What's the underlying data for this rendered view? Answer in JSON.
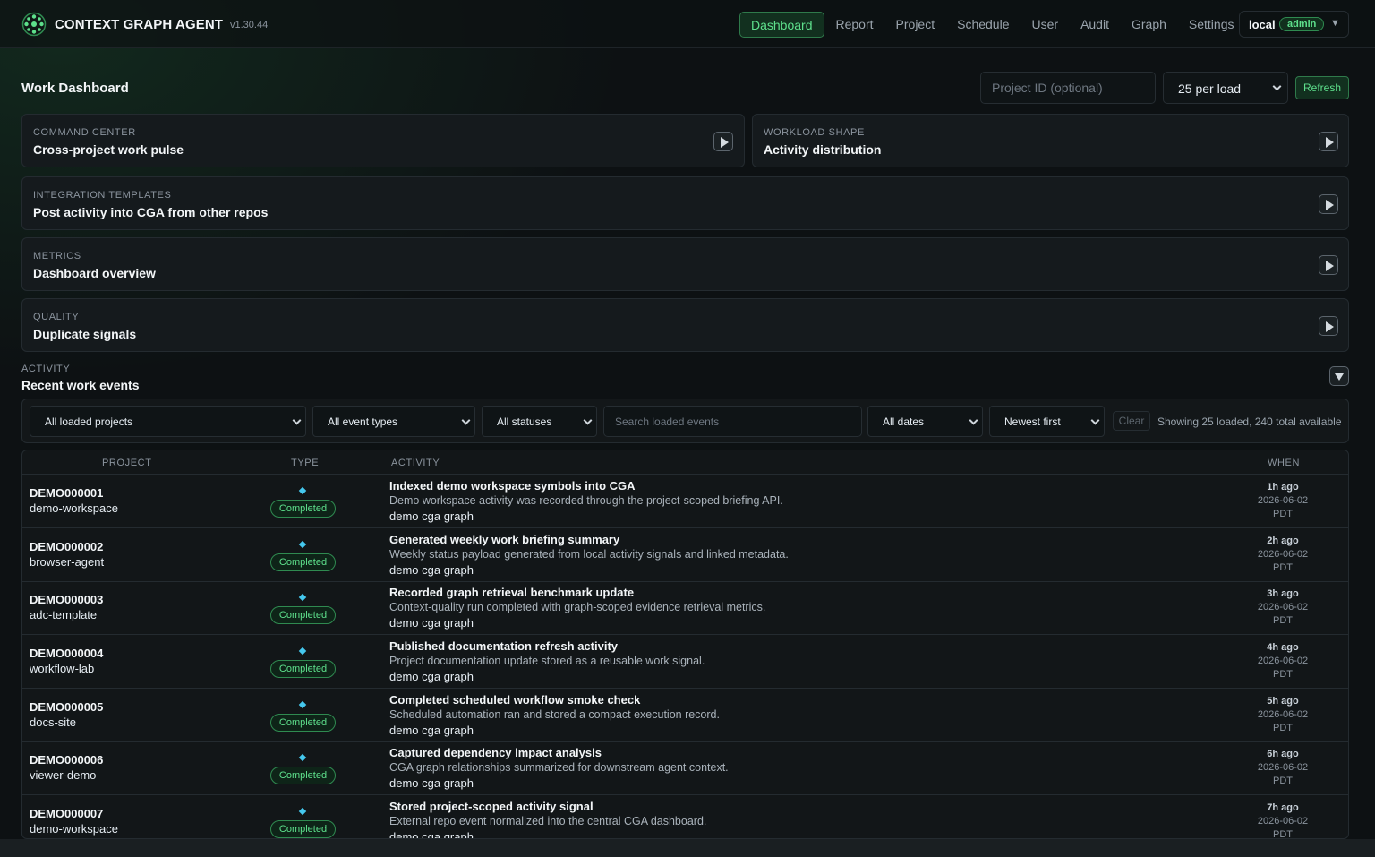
{
  "app": {
    "name": "CONTEXT GRAPH AGENT",
    "version": "v1.30.44"
  },
  "nav": {
    "items": [
      {
        "label": "Dashboard",
        "active": true
      },
      {
        "label": "Report"
      },
      {
        "label": "Project"
      },
      {
        "label": "Schedule"
      },
      {
        "label": "User"
      },
      {
        "label": "Audit"
      },
      {
        "label": "Graph"
      },
      {
        "label": "Settings"
      }
    ],
    "user": "local",
    "role": "admin"
  },
  "page": {
    "title": "Work Dashboard",
    "project_placeholder": "Project ID (optional)",
    "per_load": "25 per load",
    "refresh_label": "Refresh"
  },
  "panels": [
    {
      "kicker": "COMMAND CENTER",
      "title": "Cross-project work pulse"
    },
    {
      "kicker": "WORKLOAD SHAPE",
      "title": "Activity distribution"
    },
    {
      "kicker": "INTEGRATION TEMPLATES",
      "title": "Post activity into CGA from other repos"
    },
    {
      "kicker": "METRICS",
      "title": "Dashboard overview"
    },
    {
      "kicker": "QUALITY",
      "title": "Duplicate signals"
    }
  ],
  "activity": {
    "kicker": "ACTIVITY",
    "title": "Recent work events",
    "filters": {
      "projects": "All loaded projects",
      "event_types": "All event types",
      "statuses": "All statuses",
      "search_placeholder": "Search loaded events",
      "dates": "All dates",
      "sort": "Newest first",
      "clear": "Clear",
      "showing": "Showing 25 loaded, 240 total available"
    },
    "columns": {
      "project": "PROJECT",
      "type": "TYPE",
      "activity": "ACTIVITY",
      "when": "WHEN"
    },
    "rows": [
      {
        "id": "DEMO000001",
        "project": "demo-workspace",
        "status": "Completed",
        "title": "Indexed demo workspace symbols into CGA",
        "desc": "Demo workspace activity was recorded through the project-scoped briefing API.",
        "tags": "demo cga graph",
        "rel": "1h ago",
        "date": "2026-06-02",
        "tz": "PDT"
      },
      {
        "id": "DEMO000002",
        "project": "browser-agent",
        "status": "Completed",
        "title": "Generated weekly work briefing summary",
        "desc": "Weekly status payload generated from local activity signals and linked metadata.",
        "tags": "demo cga graph",
        "rel": "2h ago",
        "date": "2026-06-02",
        "tz": "PDT"
      },
      {
        "id": "DEMO000003",
        "project": "adc-template",
        "status": "Completed",
        "title": "Recorded graph retrieval benchmark update",
        "desc": "Context-quality run completed with graph-scoped evidence retrieval metrics.",
        "tags": "demo cga graph",
        "rel": "3h ago",
        "date": "2026-06-02",
        "tz": "PDT"
      },
      {
        "id": "DEMO000004",
        "project": "workflow-lab",
        "status": "Completed",
        "title": "Published documentation refresh activity",
        "desc": "Project documentation update stored as a reusable work signal.",
        "tags": "demo cga graph",
        "rel": "4h ago",
        "date": "2026-06-02",
        "tz": "PDT"
      },
      {
        "id": "DEMO000005",
        "project": "docs-site",
        "status": "Completed",
        "title": "Completed scheduled workflow smoke check",
        "desc": "Scheduled automation ran and stored a compact execution record.",
        "tags": "demo cga graph",
        "rel": "5h ago",
        "date": "2026-06-02",
        "tz": "PDT"
      },
      {
        "id": "DEMO000006",
        "project": "viewer-demo",
        "status": "Completed",
        "title": "Captured dependency impact analysis",
        "desc": "CGA graph relationships summarized for downstream agent context.",
        "tags": "demo cga graph",
        "rel": "6h ago",
        "date": "2026-06-02",
        "tz": "PDT"
      },
      {
        "id": "DEMO000007",
        "project": "demo-workspace",
        "status": "Completed",
        "title": "Stored project-scoped activity signal",
        "desc": "External repo event normalized into the central CGA dashboard.",
        "tags": "demo cga graph",
        "rel": "7h ago",
        "date": "2026-06-02",
        "tz": "PDT"
      }
    ]
  },
  "colors": {
    "accent": "#5ee08c",
    "type_marker": "#45c8ee",
    "background": "#0d1113",
    "panel": "#151a1d"
  },
  "icons": {
    "logo": "graph-network-icon",
    "play": "play-icon",
    "collapse": "chevron-down-icon"
  }
}
